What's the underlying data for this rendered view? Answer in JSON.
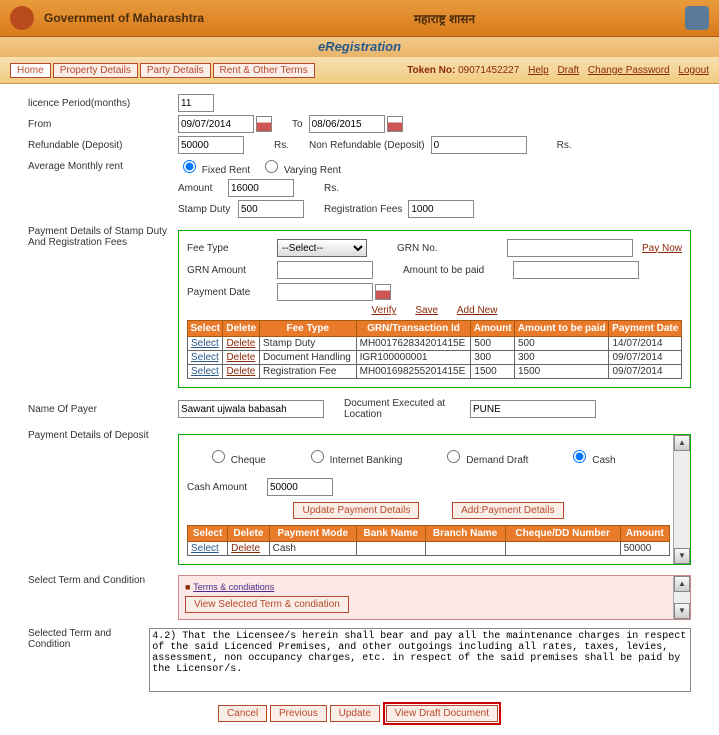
{
  "header": {
    "gov": "Government of Maharashtra",
    "marathi": "महाराष्ट्र शासन",
    "sub": "eRegistration"
  },
  "tabs": [
    "Home",
    "Property Details",
    "Party Details",
    "Rent & Other Terms"
  ],
  "token": {
    "label": "Token No:",
    "value": "09071452227",
    "links": [
      "Help",
      "Draft",
      "Change Password",
      "Logout"
    ]
  },
  "licence": {
    "period_label": "licence Period(months)",
    "period": "11",
    "from_label": "From",
    "from": "09/07/2014",
    "to_label": "To",
    "to": "08/06/2015",
    "refdep_label": "Refundable (Deposit)",
    "refdep": "50000",
    "rs": "Rs.",
    "nonref_label": "Non Refundable (Deposit)",
    "nonref": "0",
    "avg_label": "Average Monthly rent",
    "fixed": "Fixed Rent",
    "varying": "Varying Rent",
    "amount_label": "Amount",
    "amount": "16000",
    "stamp_label": "Stamp Duty",
    "stamp": "500",
    "regfee_label": "Registration Fees",
    "regfee": "1000"
  },
  "pay": {
    "section_label": "Payment Details of Stamp Duty And Registration Fees",
    "feetype_label": "Fee Type",
    "feetype_sel": "--Select--",
    "grn_label": "GRN No.",
    "grnamt_label": "GRN Amount",
    "amtpaid_label": "Amount to be paid",
    "paydate_label": "Payment Date",
    "paynow": "Pay Now",
    "verify": "Verify",
    "save": "Save",
    "addnew": "Add New",
    "cols": [
      "Select",
      "Delete",
      "Fee Type",
      "GRN/Transaction Id",
      "Amount",
      "Amount to be paid",
      "Payment Date"
    ],
    "rows": [
      {
        "ft": "Stamp Duty",
        "grn": "MH001762834201415E",
        "amt": "500",
        "amtp": "500",
        "pd": "14/07/2014"
      },
      {
        "ft": "Document Handling",
        "grn": "IGR100000001",
        "amt": "300",
        "amtp": "300",
        "pd": "09/07/2014"
      },
      {
        "ft": "Registration Fee",
        "grn": "MH001698255201415E",
        "amt": "1500",
        "amtp": "1500",
        "pd": "09/07/2014"
      }
    ]
  },
  "payer": {
    "label": "Name Of Payer",
    "value": "Sawant ujwala babasah",
    "docloc_label": "Document Executed at Location",
    "docloc": "PUNE"
  },
  "deposit": {
    "label": "Payment Details of Deposit",
    "opts": [
      "Cheque",
      "Internet Banking",
      "Demand Draft",
      "Cash"
    ],
    "cashamt_label": "Cash Amount",
    "cashamt": "50000",
    "upd": "Update Payment Details",
    "add": "Add:Payment Details",
    "cols": [
      "Select",
      "Delete",
      "Payment Mode",
      "Bank Name",
      "Branch Name",
      "Cheque/DD Number",
      "Amount"
    ],
    "row": {
      "mode": "Cash",
      "bank": "",
      "branch": "",
      "chq": "",
      "amt": "50000"
    }
  },
  "terms": {
    "sel_label": "Select Term and Condition",
    "link": "Terms & condiations",
    "btn": "View Selected Term & condiation",
    "selcond_label": "Selected Term and Condition",
    "text": "4.2) That the Licensee/s herein shall bear and pay all the maintenance charges in respect of the said Licenced Premises, and other outgoings including all rates, taxes, levies, assessment, non occupancy charges, etc. in respect of the said premises shall be paid by the Licensor/s."
  },
  "bottom": {
    "cancel": "Cancel",
    "prev": "Previous",
    "upd": "Update",
    "view": "View Draft Document"
  },
  "icons": {
    "cal": "calendar-icon"
  }
}
